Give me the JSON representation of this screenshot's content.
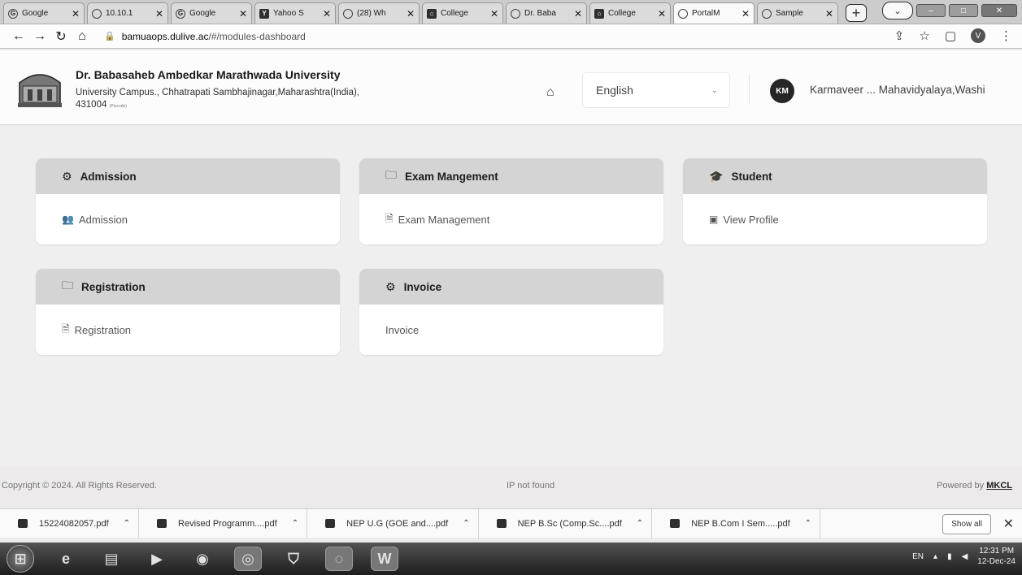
{
  "browser": {
    "tabs": [
      {
        "label": "Google",
        "icon": "google-icon",
        "active": false
      },
      {
        "label": "10.10.1",
        "icon": "globe-icon",
        "active": false
      },
      {
        "label": "Google",
        "icon": "google-icon",
        "active": false
      },
      {
        "label": "Yahoo S",
        "icon": "yahoo-icon",
        "active": false
      },
      {
        "label": "(28) Wh",
        "icon": "whatsapp-icon",
        "active": false
      },
      {
        "label": "College",
        "icon": "college-icon",
        "active": false
      },
      {
        "label": "Dr. Baba",
        "icon": "globe-icon",
        "active": false
      },
      {
        "label": "College",
        "icon": "college-icon",
        "active": false
      },
      {
        "label": "PortalM",
        "icon": "portal-icon",
        "active": true
      },
      {
        "label": "Sample",
        "icon": "globe-icon",
        "active": false
      }
    ],
    "url_host": "bamuaops.dulive.ac",
    "url_path": "/#/modules-dashboard",
    "profile_initial": "V"
  },
  "header": {
    "university_name": "Dr. Babasaheb Ambedkar Marathwada University",
    "address_line": "University Campus., Chhatrapati Sambhajinagar,Maharashtra(India),",
    "pincode": "431004",
    "pin_extra": "(Pincode)",
    "language": "English",
    "user_initials": "KM",
    "user_name": "Karmaveer ... Mahavidyalaya,Washi"
  },
  "cards": [
    {
      "title": "Admission",
      "title_icon": "modules-icon",
      "item": "Admission",
      "item_icon": "users-icon"
    },
    {
      "title": "Exam Mangement",
      "title_icon": "folder-icon",
      "item": "Exam Management",
      "item_icon": "document-icon"
    },
    {
      "title": "Student",
      "title_icon": "graduation-cap-icon",
      "item": "View Profile",
      "item_icon": "profile-card-icon"
    },
    {
      "title": "Registration",
      "title_icon": "folder-icon",
      "item": "Registration",
      "item_icon": "document-icon"
    },
    {
      "title": "Invoice",
      "title_icon": "modules-icon",
      "item": "Invoice",
      "item_icon": ""
    }
  ],
  "footer": {
    "copyright": "Copyright © 2024. All Rights Reserved.",
    "ip": "IP not found",
    "powered_prefix": "Powered by ",
    "powered_brand": "MKCL"
  },
  "downloads": {
    "items": [
      "15224082057.pdf",
      "Revised Programm....pdf",
      "NEP U.G (GOE and....pdf",
      "NEP B.Sc (Comp.Sc....pdf",
      "NEP B.Com I Sem.....pdf"
    ],
    "show_all": "Show all"
  },
  "taskbar": {
    "lang": "EN",
    "time": "12:31 PM",
    "date": "12-Dec-24"
  }
}
